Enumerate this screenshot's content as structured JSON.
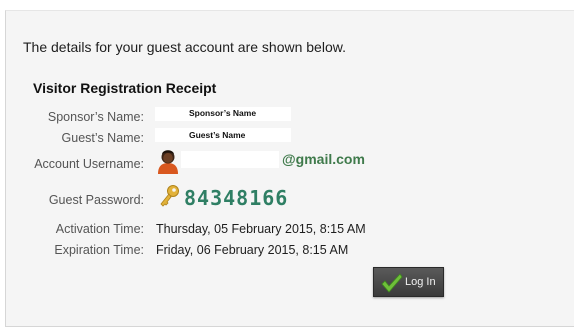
{
  "intro_text": "The details for your guest account are shown below.",
  "receipt": {
    "title": "Visitor Registration Receipt",
    "sponsor": {
      "label": "Sponsor’s Name:",
      "value": "Sponsor’s Name"
    },
    "guest": {
      "label": "Guest’s Name:",
      "value": "Guest’s Name"
    },
    "username": {
      "label": "Account Username:",
      "value": "@gmail.com",
      "icon": "user-avatar-icon"
    },
    "password": {
      "label": "Guest Password:",
      "value": "84348166",
      "icon": "key-icon"
    },
    "activation": {
      "label": "Activation Time:",
      "value": "Thursday, 05 February 2015, 8:15 AM"
    },
    "expiration": {
      "label": "Expiration Time:",
      "value": "Friday, 06 February 2015, 8:15 AM"
    }
  },
  "login_button": {
    "label": "Log In",
    "icon": "checkmark-icon"
  },
  "colors": {
    "panel_bg": "#f5f5f5",
    "password_text": "#2f7f64",
    "email_text": "#3f7a4b",
    "button_bg": "#4a4a4a",
    "check_green": "#6fbf3a"
  }
}
